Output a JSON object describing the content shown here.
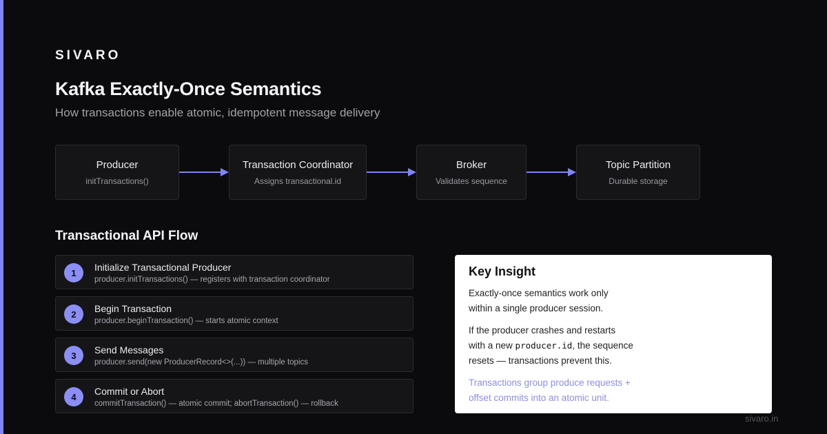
{
  "brand": "SIVARO",
  "title": "Kafka Exactly-Once Semantics",
  "subtitle": "How transactions enable atomic, idempotent message delivery",
  "flow": {
    "nodes": [
      {
        "title": "Producer",
        "sub": "initTransactions()"
      },
      {
        "title": "Transaction Coordinator",
        "sub": "Assigns transactional.id"
      },
      {
        "title": "Broker",
        "sub": "Validates sequence"
      },
      {
        "title": "Topic Partition",
        "sub": "Durable storage"
      }
    ],
    "arrow_color": "#7f85f3"
  },
  "api_flow": {
    "title": "Transactional API Flow",
    "steps": [
      {
        "num": "1",
        "title": "Initialize Transactional Producer",
        "sub": "producer.initTransactions() — registers with transaction coordinator"
      },
      {
        "num": "2",
        "title": "Begin Transaction",
        "sub": "producer.beginTransaction() — starts atomic context"
      },
      {
        "num": "3",
        "title": "Send Messages",
        "sub": "producer.send(new ProducerRecord<>(...)) — multiple topics"
      },
      {
        "num": "4",
        "title": "Commit or Abort",
        "sub": "commitTransaction() — atomic commit; abortTransaction() — rollback"
      }
    ]
  },
  "insight": {
    "title": "Key Insight",
    "p1_line1": "Exactly-once semantics work only",
    "p1_line2": "within a single producer session.",
    "p2_line1": "If the producer crashes and restarts",
    "p2_line2_pre": "with a new ",
    "p2_code": "producer.id",
    "p2_line2_post": ", the sequence",
    "p2_line3": "resets — transactions prevent this.",
    "note_line1": "Transactions group produce requests +",
    "note_line2": "offset commits into an atomic unit."
  },
  "footer": "sivaro.in",
  "colors": {
    "accent": "#7f85f3",
    "step_badge": "#8b8ff5",
    "background": "#0b0b0d"
  }
}
